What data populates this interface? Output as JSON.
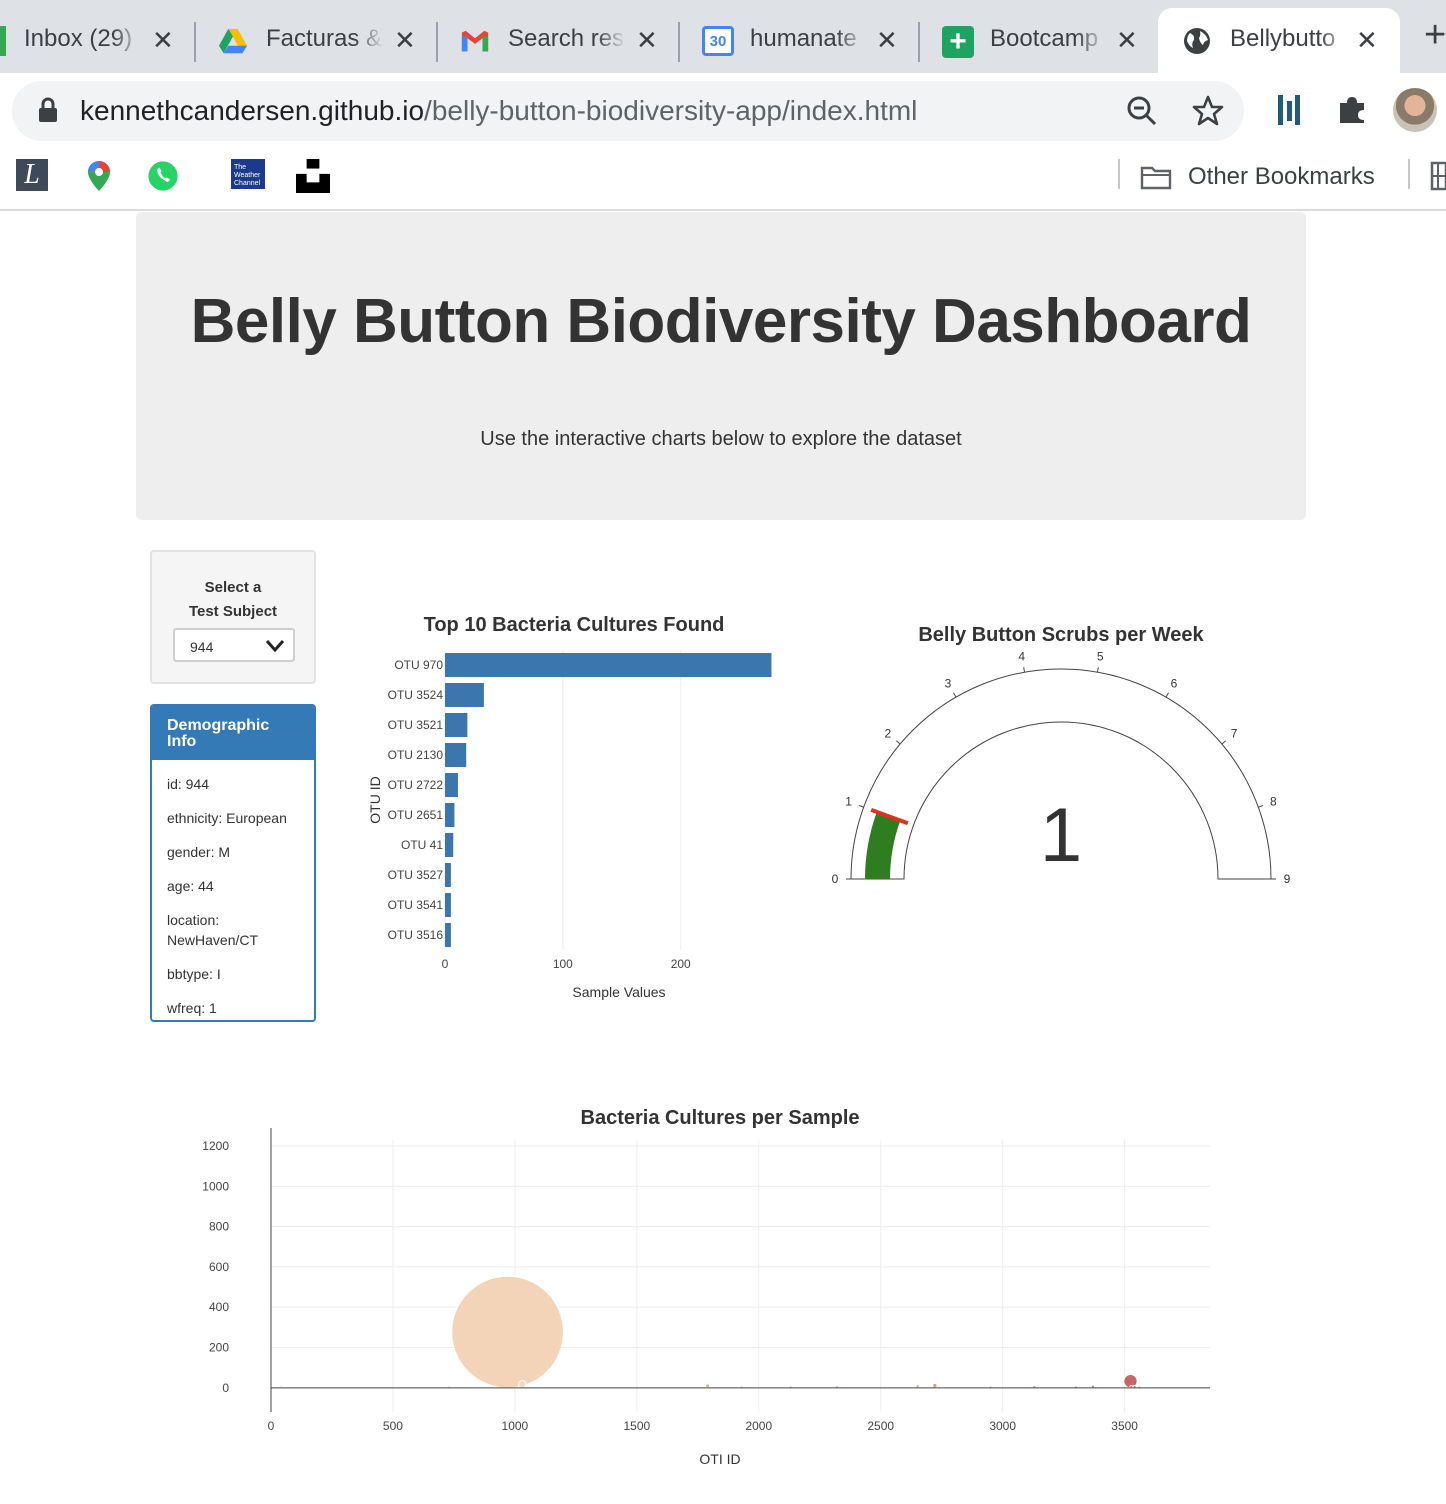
{
  "browser": {
    "tabs": [
      {
        "title": "Inbox (29)",
        "favicon": "gmail-icon"
      },
      {
        "title": "Facturas & ",
        "favicon": "google-drive-icon"
      },
      {
        "title": "Search res",
        "favicon": "gmail-icon"
      },
      {
        "title": "humanate",
        "favicon": "google-calendar-icon"
      },
      {
        "title": "Bootcamp",
        "favicon": "google-sheets-icon"
      },
      {
        "title": "Bellybutto",
        "favicon": "globe-icon"
      }
    ],
    "calendar_day": "30",
    "url_host": "kennethcandersen.github.io",
    "url_path": "/belly-button-biodiversity-app/index.html",
    "other_bookmarks": "Other Bookmarks",
    "weather_channel_logo": "The Weather Channel"
  },
  "page": {
    "title": "Belly Button Biodiversity Dashboard",
    "subtitle": "Use the interactive charts below to explore the dataset",
    "select_label_1": "Select a",
    "select_label_2": "Test Subject",
    "selected_subject": "944",
    "demo_title": "Demographic Info",
    "demographics": [
      "id: 944",
      "ethnicity: European",
      "gender: M",
      "age: 44",
      "location: NewHaven/CT",
      "bbtype: I",
      "wfreq: 1"
    ]
  },
  "colors": {
    "bar": "#3b76af",
    "gauge_bar": "#2e7d1e",
    "gauge_threshold": "#e0301e",
    "demo_header": "#337ab7"
  },
  "chart_data": [
    {
      "type": "bar",
      "orientation": "horizontal",
      "title": "Top 10 Bacteria Cultures Found",
      "xlabel": "Sample Values",
      "ylabel": "OTU ID",
      "categories": [
        "OTU 970",
        "OTU 3524",
        "OTU 3521",
        "OTU 2130",
        "OTU 2722",
        "OTU 2651",
        "OTU 41",
        "OTU 3527",
        "OTU 3541",
        "OTU 3516"
      ],
      "values": [
        277,
        33,
        19,
        18,
        11,
        8,
        7,
        5,
        5,
        5
      ],
      "xticks": [
        "0",
        "100",
        "200"
      ],
      "xlim": [
        0,
        280
      ]
    },
    {
      "type": "gauge",
      "title": "Belly Button Scrubs per Week",
      "value": 1,
      "display_value": "1",
      "range": [
        0,
        9
      ],
      "threshold": 1,
      "ticks": [
        "0",
        "1",
        "2",
        "3",
        "4",
        "5",
        "6",
        "7",
        "8",
        "9"
      ]
    },
    {
      "type": "scatter",
      "mode": "bubble",
      "title": "Bacteria Cultures per Sample",
      "xlabel": "OTI ID",
      "ylabel": "",
      "xlim": [
        0,
        3850
      ],
      "ylim": [
        -120,
        1230
      ],
      "xticks": [
        "0",
        "500",
        "1000",
        "1500",
        "2000",
        "2500",
        "3000",
        "3500"
      ],
      "yticks": [
        "0",
        "200",
        "400",
        "600",
        "800",
        "1000",
        "1200"
      ],
      "x": [
        41,
        730,
        940,
        970,
        1030,
        1790,
        1930,
        2130,
        2320,
        2651,
        2722,
        2950,
        3130,
        3300,
        3370,
        3516,
        3524,
        3527,
        3541,
        3560
      ],
      "y": [
        7,
        2,
        14,
        277,
        18,
        10,
        2,
        3,
        4,
        8,
        11,
        2,
        4,
        2,
        6,
        5,
        33,
        5,
        5,
        2
      ],
      "colors": [
        "#ffe9d9",
        "#f3d3bb",
        "#f2d6c4",
        "#f2cfb0",
        "#f2d6c4",
        "#e7a68a",
        "#ebc0a8",
        "#e8b39a",
        "#e6a48e",
        "#dd8f7e",
        "#dc8f80",
        "#d99a90",
        "#cf6f6a",
        "#d07a77",
        "#c65b57",
        "#c8706e",
        "#c25453",
        "#d8928f",
        "#c96a6a",
        "#d59595"
      ]
    }
  ]
}
